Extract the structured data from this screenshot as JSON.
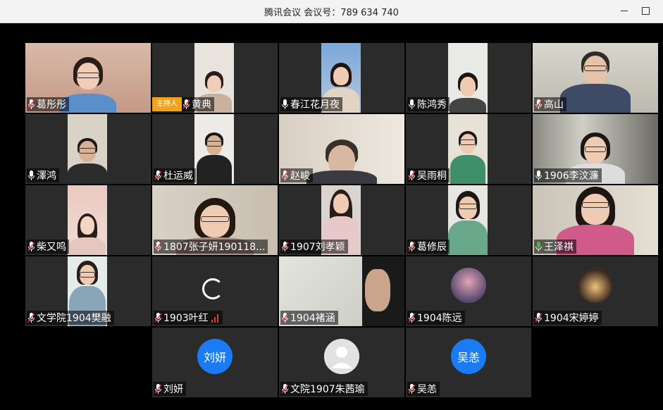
{
  "window": {
    "title": "腾讯会议 会议号：789 634 740"
  },
  "host_badge": "主持人",
  "participants": [
    {
      "name": "葛彤彤"
    },
    {
      "name": "黄典"
    },
    {
      "name": "春江花月夜"
    },
    {
      "name": "陈鸿秀"
    },
    {
      "name": "高山"
    },
    {
      "name": "澤鸿"
    },
    {
      "name": "杜运威"
    },
    {
      "name": "赵峻"
    },
    {
      "name": "吴雨桐"
    },
    {
      "name": "1906李汶濂"
    },
    {
      "name": "柴又鸣"
    },
    {
      "name": "1807张子妍190118..."
    },
    {
      "name": "1907刘孝颖"
    },
    {
      "name": "葛修辰"
    },
    {
      "name": "王泽祺"
    },
    {
      "name": "文学院1904樊融"
    },
    {
      "name": "1903叶红"
    },
    {
      "name": "1904褚涵"
    },
    {
      "name": "1904陈远"
    },
    {
      "name": "1904宋婷婷"
    },
    {
      "name": "刘妍",
      "avatar_text": "刘妍"
    },
    {
      "name": "文院1907朱茜瑜"
    },
    {
      "name": "吴恙",
      "avatar_text": "吴恙"
    }
  ],
  "colors": {
    "host_badge": "#f2a31b",
    "avatar_blue": "#1a7cf5",
    "muted_mic": "#e03c3c",
    "active_mic": "#4caf50"
  }
}
